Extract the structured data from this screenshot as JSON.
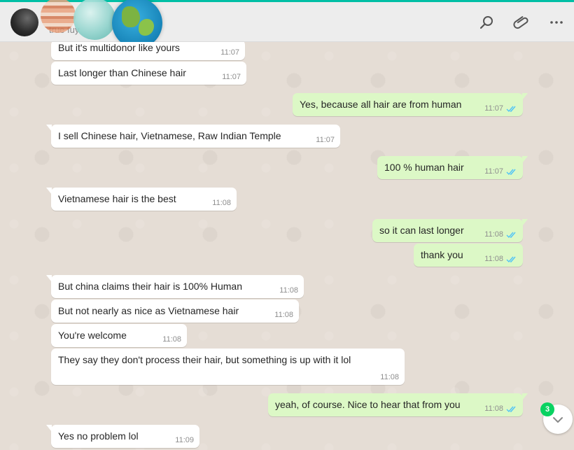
{
  "header": {
    "contact_name": "true fuy",
    "icons": [
      "search-icon",
      "paperclip-icon",
      "more-options-icon"
    ]
  },
  "colors": {
    "accent": "#00bfa5",
    "incoming_bubble": "#ffffff",
    "outgoing_bubble": "#dcf8c6",
    "read_ticks": "#4fc3f7",
    "unread_badge": "#09d261"
  },
  "messages": [
    {
      "direction": "in",
      "text": "But it's multidonor like yours",
      "time": "11:07"
    },
    {
      "direction": "in",
      "text": "Last longer than Chinese hair",
      "time": "11:07"
    },
    {
      "direction": "out",
      "text": "Yes, because all hair are from human",
      "time": "11:07",
      "status": "read"
    },
    {
      "direction": "in",
      "text": "I sell Chinese hair, Vietnamese, Raw Indian Temple",
      "time": "11:07"
    },
    {
      "direction": "out",
      "text": "100 % human hair",
      "time": "11:07",
      "status": "read"
    },
    {
      "direction": "in",
      "text": "Vietnamese hair is the best",
      "time": "11:08"
    },
    {
      "direction": "out",
      "text": "so it can last longer",
      "time": "11:08",
      "status": "read"
    },
    {
      "direction": "out",
      "text": "thank you",
      "time": "11:08",
      "status": "read"
    },
    {
      "direction": "in",
      "text": "But china claims their hair is 100% Human",
      "time": "11:08"
    },
    {
      "direction": "in",
      "text": "But not nearly as nice as Vietnamese hair",
      "time": "11:08"
    },
    {
      "direction": "in",
      "text": "You're welcome",
      "time": "11:08"
    },
    {
      "direction": "in",
      "text": "They say they don't process their hair, but something is up with it lol",
      "time": "11:08"
    },
    {
      "direction": "out",
      "text": "yeah, of course. Nice to hear that from you",
      "time": "11:08",
      "status": "read"
    },
    {
      "direction": "in",
      "text": "Yes no problem lol",
      "time": "11:09"
    }
  ],
  "scroll": {
    "unread_count": "3",
    "icon": "chevron-down-icon"
  }
}
